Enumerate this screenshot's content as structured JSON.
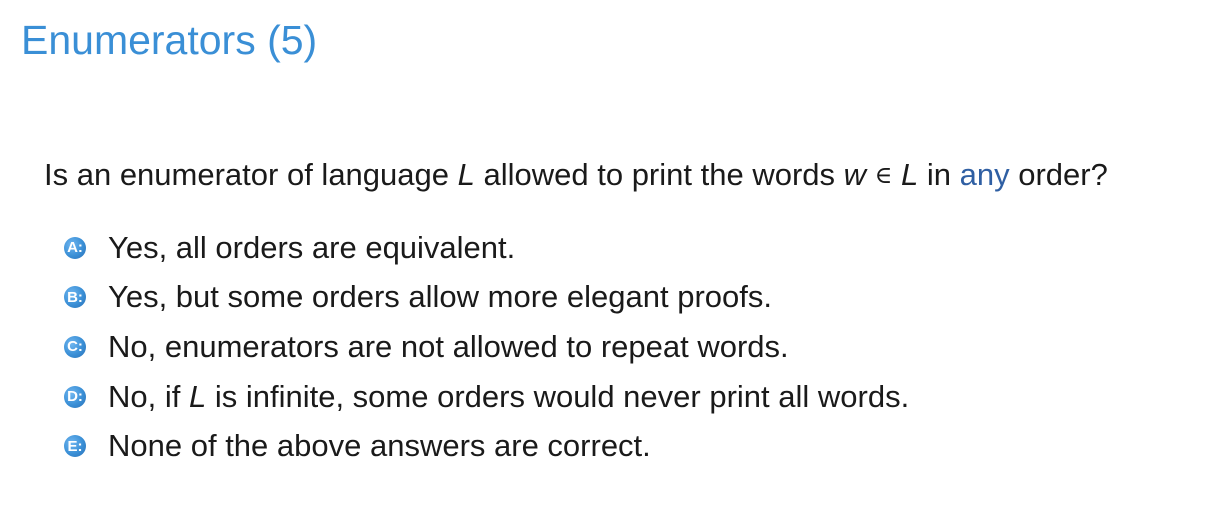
{
  "slide": {
    "title": "Enumerators (5)"
  },
  "question": {
    "part1": "Is an enumerator of language ",
    "var_L": "L",
    "part2": " allowed to print the words ",
    "var_w": "w",
    "elem_of": "∈",
    "var_L2": "L",
    "part3": " in ",
    "emphasis": "any",
    "part4": " order?"
  },
  "options": [
    {
      "marker": "A:",
      "text": "Yes, all orders are equivalent."
    },
    {
      "marker": "B:",
      "text": "Yes, but some orders allow more elegant proofs."
    },
    {
      "marker": "C:",
      "text": "No, enumerators are not allowed to repeat words."
    },
    {
      "marker": "D:",
      "text_before": "No, if ",
      "var": "L",
      "text_after": " is infinite, some orders would never print all words."
    },
    {
      "marker": "E:",
      "text": "None of the above answers are correct."
    }
  ],
  "colors": {
    "title": "#3a8fd6",
    "emphasis": "#2f5fa3",
    "marker": "#3a8fd6"
  }
}
